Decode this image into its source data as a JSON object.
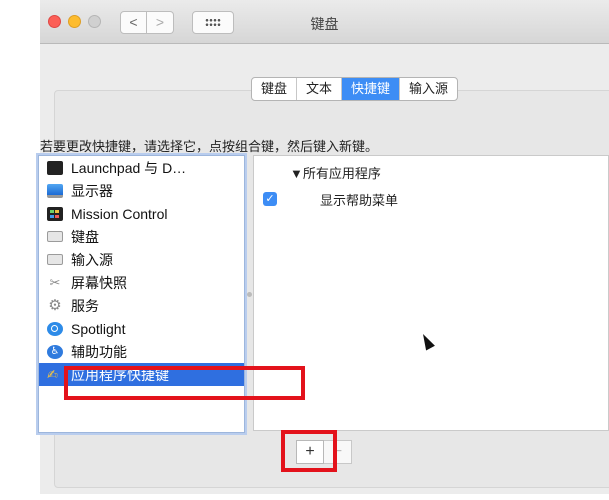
{
  "window": {
    "title": "键盘",
    "nav": {
      "back": "<",
      "forward": ">"
    }
  },
  "tabs": [
    {
      "label": "键盘",
      "active": false
    },
    {
      "label": "文本",
      "active": false
    },
    {
      "label": "快捷键",
      "active": true
    },
    {
      "label": "输入源",
      "active": false
    }
  ],
  "instruction": "若要更改快捷键，请选择它，点按组合键，然后键入新键。",
  "categories": [
    {
      "label": "Launchpad 与 D…",
      "icon": "launchpad-icon"
    },
    {
      "label": "显示器",
      "icon": "display-icon"
    },
    {
      "label": "Mission Control",
      "icon": "mission-control-icon"
    },
    {
      "label": "键盘",
      "icon": "keyboard-icon"
    },
    {
      "label": "输入源",
      "icon": "input-source-icon"
    },
    {
      "label": "屏幕快照",
      "icon": "screenshot-icon"
    },
    {
      "label": "服务",
      "icon": "services-icon"
    },
    {
      "label": "Spotlight",
      "icon": "spotlight-icon"
    },
    {
      "label": "辅助功能",
      "icon": "accessibility-icon"
    },
    {
      "label": "应用程序快捷键",
      "icon": "app-shortcuts-icon",
      "selected": true
    }
  ],
  "shortcuts": {
    "group_label": "▼所有应用程序",
    "items": [
      {
        "label": "显示帮助菜单",
        "checked": true
      }
    ]
  },
  "buttons": {
    "add": "+",
    "remove": "−"
  },
  "colors": {
    "accent": "#3d8df5",
    "selection": "#2f6fe0",
    "highlight": "#e3121b"
  }
}
